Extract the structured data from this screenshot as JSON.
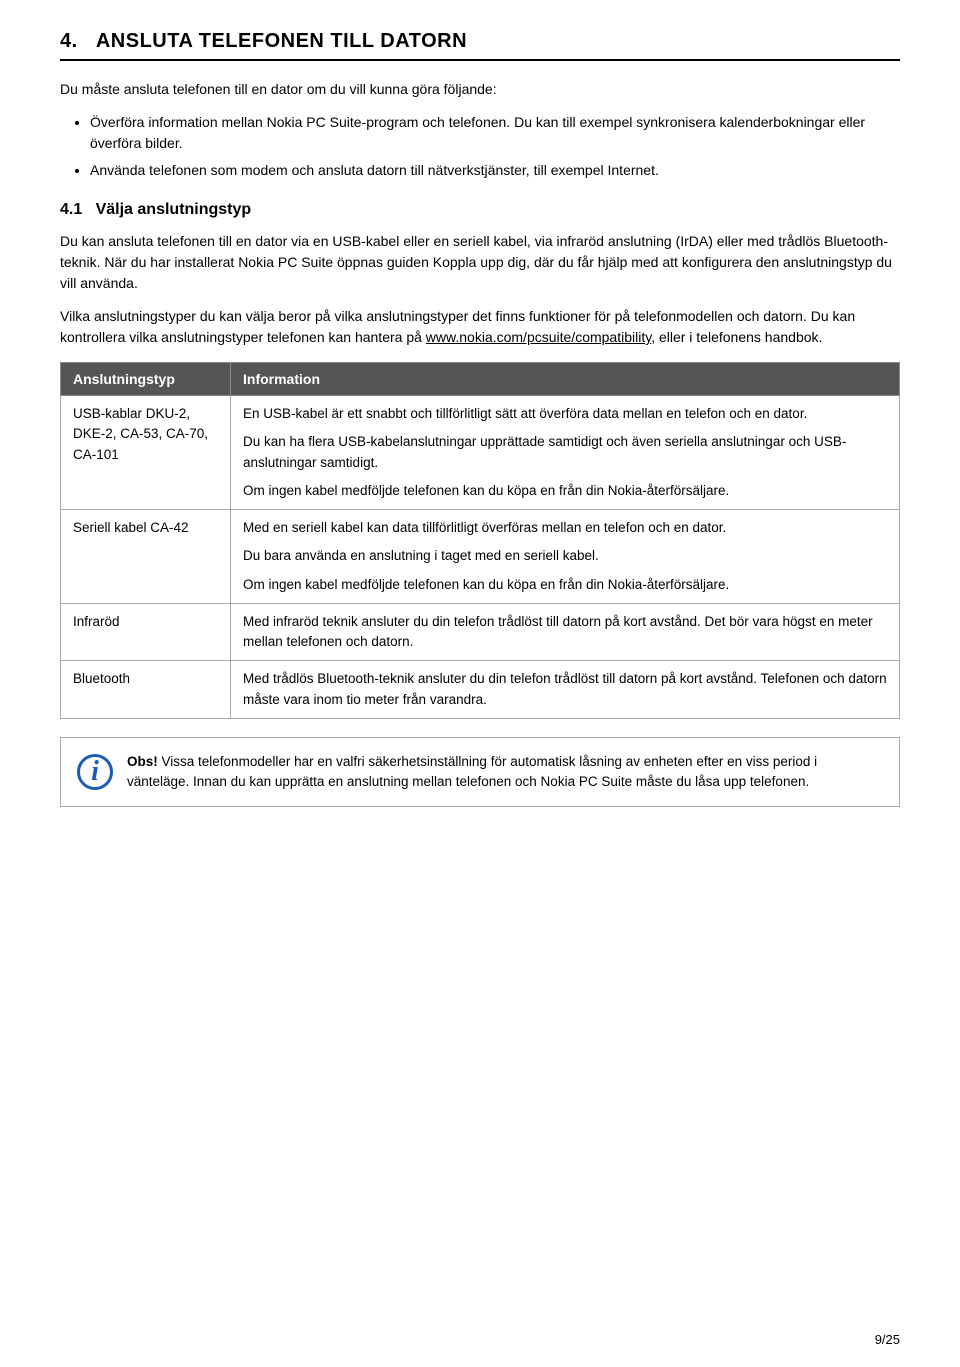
{
  "page": {
    "title": "4.  ANSLUTA TELEFONEN TILL DATORN",
    "title_number": "4.",
    "title_text": "ANSLUTA TELEFONEN TILL DATORN",
    "intro_p1": "Du måste ansluta telefonen till en dator om du vill kunna göra följande:",
    "bullet1": "Överföra information mellan Nokia PC Suite-program och telefonen. Du kan till exempel synkronisera kalenderbokningar eller överföra bilder.",
    "bullet2": "Använda telefonen som modem och ansluta datorn till nätverkstjänster, till exempel Internet.",
    "subsection_number": "4.1",
    "subsection_title": "Välja anslutningstyp",
    "sub_p1": "Du kan ansluta telefonen till en dator via en USB-kabel eller en seriell kabel, via infraröd anslutning (IrDA) eller med trådlös Bluetooth-teknik. När du har installerat Nokia PC Suite öppnas guiden Koppla upp dig, där du får hjälp med att konfigurera den anslutningstyp du vill använda.",
    "sub_p2": "Vilka anslutningstyper du kan välja beror på vilka anslutningstyper det finns funktioner för på telefonmodellen och datorn. Du kan kontrollera vilka anslutningstyper telefonen kan hantera på ",
    "sub_p2_link": "www.nokia.com/pcsuite/compatibility",
    "sub_p2_end": ", eller i telefonens handbok.",
    "table": {
      "col1_header": "Anslutningstyp",
      "col2_header": "Information",
      "rows": [
        {
          "type": "USB-kablar DKU-2, DKE-2, CA-53, CA-70, CA-101",
          "info_blocks": [
            "En USB-kabel är ett snabbt och tillförlitligt sätt att överföra data mellan en telefon och en dator.",
            "Du kan ha flera USB-kabelanslutningar upprättade samtidigt och även seriella anslutningar och USB-anslutningar samtidigt.",
            "Om ingen kabel medföljde telefonen kan du köpa en från din Nokia-återförsäljare."
          ]
        },
        {
          "type": "Seriell kabel CA-42",
          "info_blocks": [
            "Med en seriell kabel kan data tillförlitligt överföras mellan en telefon och en dator.",
            "Du bara använda en anslutning i taget med en seriell kabel.",
            "Om ingen kabel medföljde telefonen kan du köpa en från din Nokia-återförsäljare."
          ]
        },
        {
          "type": "Infraröd",
          "info_blocks": [
            "Med infraröd teknik ansluter du din telefon trådlöst till datorn på kort avstånd. Det bör vara högst en meter mellan telefonen och datorn."
          ]
        },
        {
          "type": "Bluetooth",
          "info_blocks": [
            "Med trådlös Bluetooth-teknik ansluter du din telefon trådlöst till datorn på kort avstånd. Telefonen och datorn måste vara inom tio meter från varandra."
          ]
        }
      ]
    },
    "obs_label": "Obs!",
    "obs_text": " Vissa telefonmodeller har en valfri säkerhetsinställning för automatisk låsning av enheten efter en viss period i vänteläge. Innan du kan upprätta en anslutning mellan telefonen och Nokia PC Suite måste du låsa upp telefonen.",
    "page_number": "9/25"
  }
}
